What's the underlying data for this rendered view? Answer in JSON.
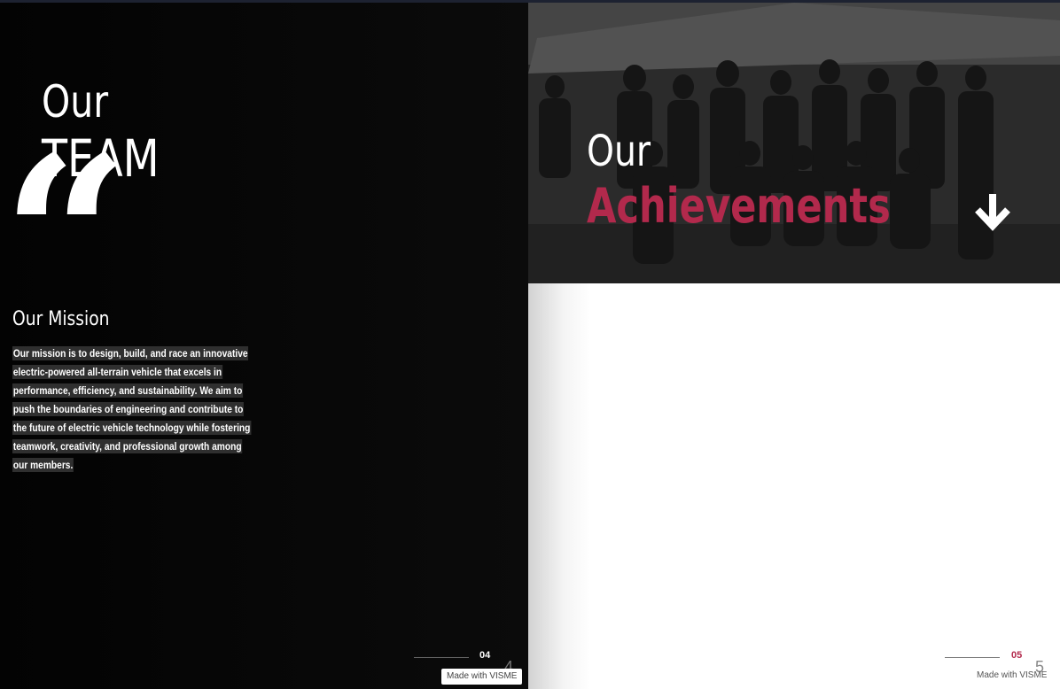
{
  "left_page": {
    "title_line1": "Our",
    "title_line2": "TEAM",
    "quote_mark": "“",
    "mission_heading": "Our Mission",
    "mission_text": "Our mission is to design, build, and race an innovative electric-powered all-terrain vehicle that excels in performance, efficiency, and sustainability. We aim to push the boundaries of engineering and contribute to the future of electric vehicle technology while fostering teamwork, creativity, and professional growth among our members.",
    "page_number": "04",
    "page_index": "4",
    "badge": "Made with VISME"
  },
  "right_page": {
    "title_line1": "Our",
    "title_line2": "Achievements",
    "arrow_icon": "arrow-down-icon",
    "page_number": "05",
    "page_index": "5",
    "badge": "Made with VISME"
  },
  "colors": {
    "accent": "#b2294c",
    "left_background": "#070707",
    "photo_overlay": "#3c3c3c"
  }
}
